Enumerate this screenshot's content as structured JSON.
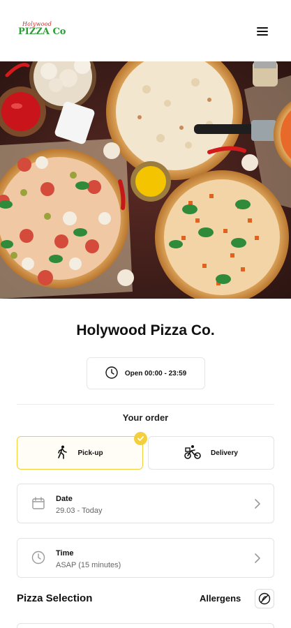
{
  "header": {
    "logo_small": "Holywood",
    "logo_text": "PIZZA Co",
    "menu_icon": "hamburger-menu-icon"
  },
  "hero": {
    "image": "pizza-photo"
  },
  "restaurant": {
    "name": "Holywood Pizza Co.",
    "hours": "Open 00:00 - 23:59",
    "hours_icon": "clock-icon"
  },
  "order": {
    "title": "Your order",
    "pickup_label": "Pick-up",
    "delivery_label": "Delivery",
    "selected": "pickup",
    "accent": "#f3cf3d"
  },
  "date": {
    "label": "Date",
    "value": "29.03 - Today",
    "icon": "calendar-icon"
  },
  "time": {
    "label": "Time",
    "value": "ASAP (15 minutes)",
    "icon": "clock-icon"
  },
  "pizza_selection": {
    "title": "Pizza Selection",
    "allergens_label": "Allergens",
    "allergens_icon": "no-allergens-icon"
  }
}
